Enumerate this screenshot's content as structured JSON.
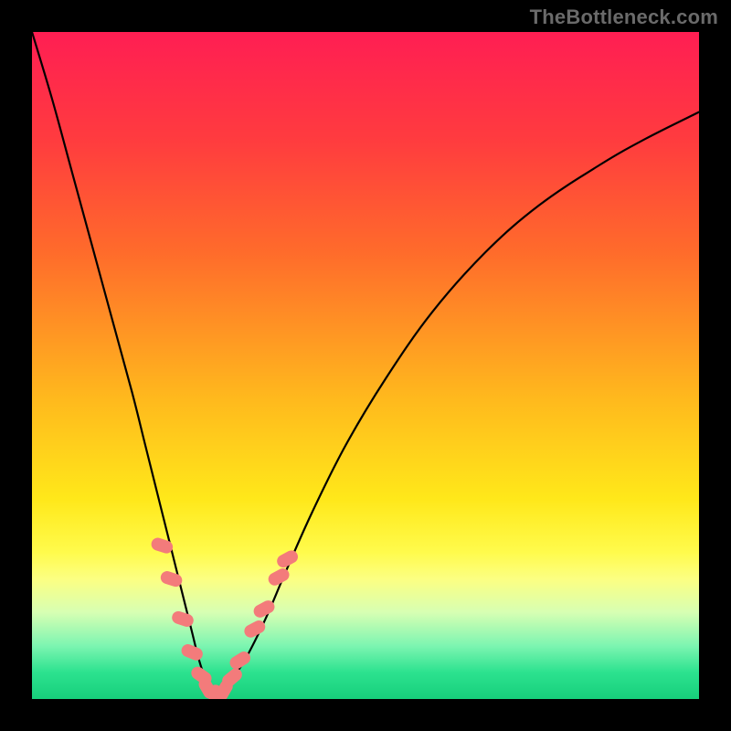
{
  "watermark": "TheBottleneck.com",
  "chart_data": {
    "type": "line",
    "title": "",
    "xlabel": "",
    "ylabel": "",
    "xlim": [
      0,
      100
    ],
    "ylim": [
      0,
      100
    ],
    "grid": false,
    "legend": false,
    "series": [
      {
        "name": "curve",
        "color": "#000000",
        "x": [
          0,
          3,
          6,
          9,
          12,
          15,
          17,
          19,
          21,
          22,
          23,
          24,
          25,
          26,
          27,
          28,
          29,
          30,
          32,
          35,
          38,
          42,
          47,
          53,
          60,
          68,
          76,
          85,
          92,
          100
        ],
        "y": [
          100,
          90,
          79,
          68,
          57,
          46,
          38,
          30,
          22,
          18,
          14,
          10,
          6,
          3,
          1,
          0,
          1,
          3,
          6,
          12,
          19,
          28,
          38,
          48,
          58,
          67,
          74,
          80,
          84,
          88
        ]
      }
    ],
    "markers": {
      "name": "pink-lozenges",
      "color": "#f37b7b",
      "points": [
        {
          "x": 19.5,
          "y": 23.0,
          "angle": 72
        },
        {
          "x": 20.9,
          "y": 18.0,
          "angle": 72
        },
        {
          "x": 22.6,
          "y": 12.0,
          "angle": 72
        },
        {
          "x": 24.0,
          "y": 7.0,
          "angle": 68
        },
        {
          "x": 25.4,
          "y": 3.5,
          "angle": 55
        },
        {
          "x": 26.3,
          "y": 1.6,
          "angle": 30
        },
        {
          "x": 27.5,
          "y": 0.5,
          "angle": 0
        },
        {
          "x": 28.8,
          "y": 1.3,
          "angle": -30
        },
        {
          "x": 30.0,
          "y": 3.2,
          "angle": -50
        },
        {
          "x": 31.2,
          "y": 5.8,
          "angle": -58
        },
        {
          "x": 33.4,
          "y": 10.5,
          "angle": -62
        },
        {
          "x": 34.8,
          "y": 13.5,
          "angle": -62
        },
        {
          "x": 37.0,
          "y": 18.3,
          "angle": -62
        },
        {
          "x": 38.3,
          "y": 21.0,
          "angle": -62
        }
      ]
    },
    "background_gradient": {
      "top": "#ff1e53",
      "bottom": "#17cf7b"
    }
  }
}
